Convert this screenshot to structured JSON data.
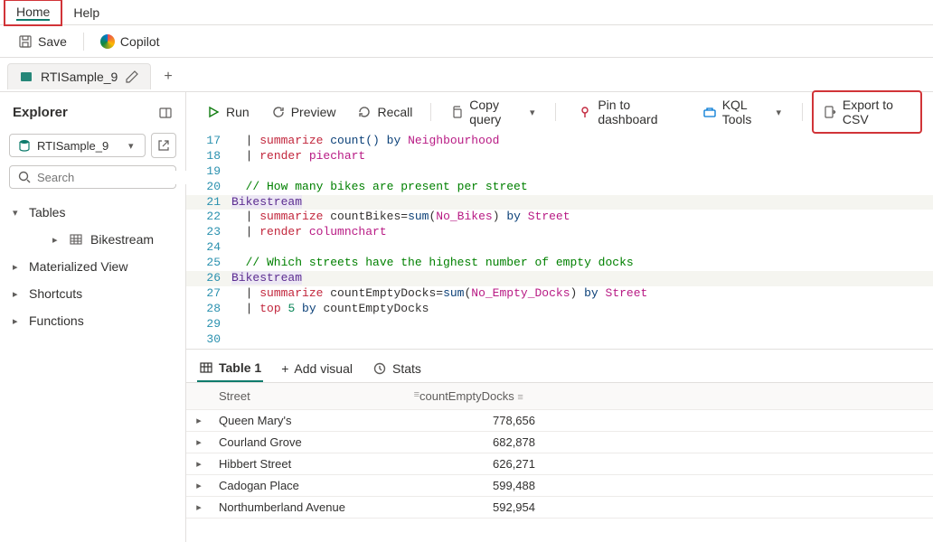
{
  "menu": {
    "home": "Home",
    "help": "Help"
  },
  "actions": {
    "save": "Save",
    "copilot": "Copilot"
  },
  "file_tab": {
    "name": "RTISample_9"
  },
  "explorer": {
    "title": "Explorer",
    "db": "RTISample_9",
    "search_placeholder": "Search",
    "tree": {
      "tables": "Tables",
      "bikestream": "Bikestream",
      "matview": "Materialized View",
      "shortcuts": "Shortcuts",
      "functions": "Functions"
    }
  },
  "toolbar": {
    "run": "Run",
    "preview": "Preview",
    "recall": "Recall",
    "copy": "Copy query",
    "pin": "Pin to dashboard",
    "kql": "KQL Tools",
    "export": "Export to CSV"
  },
  "editor_lines": [
    {
      "n": 17,
      "tokens": [
        [
          "pipe",
          "  | "
        ],
        [
          "op",
          "summarize "
        ],
        [
          "func",
          "count() "
        ],
        [
          "kw",
          "by "
        ],
        [
          "ident",
          "Neighbourhood"
        ]
      ]
    },
    {
      "n": 18,
      "tokens": [
        [
          "pipe",
          "  | "
        ],
        [
          "op",
          "render "
        ],
        [
          "ident",
          "piechart"
        ]
      ]
    },
    {
      "n": 19,
      "tokens": []
    },
    {
      "n": 20,
      "tokens": [
        [
          "comment",
          "  // How many bikes are present per street"
        ]
      ]
    },
    {
      "n": 21,
      "hl": true,
      "tokens": [
        [
          "table",
          "Bikestream"
        ]
      ]
    },
    {
      "n": 22,
      "tokens": [
        [
          "pipe",
          "  | "
        ],
        [
          "op",
          "summarize "
        ],
        [
          "plain",
          "countBikes="
        ],
        [
          "func",
          "sum"
        ],
        [
          "plain",
          "("
        ],
        [
          "ident",
          "No_Bikes"
        ],
        [
          "plain",
          ") "
        ],
        [
          "kw",
          "by "
        ],
        [
          "ident",
          "Street"
        ]
      ]
    },
    {
      "n": 23,
      "tokens": [
        [
          "pipe",
          "  | "
        ],
        [
          "op",
          "render "
        ],
        [
          "ident",
          "columnchart"
        ]
      ]
    },
    {
      "n": 24,
      "tokens": []
    },
    {
      "n": 25,
      "tokens": [
        [
          "comment",
          "  // Which streets have the highest number of empty docks"
        ]
      ]
    },
    {
      "n": 26,
      "hl": true,
      "tokens": [
        [
          "table",
          "Bikestream"
        ]
      ]
    },
    {
      "n": 27,
      "tokens": [
        [
          "pipe",
          "  | "
        ],
        [
          "op",
          "summarize "
        ],
        [
          "plain",
          "countEmptyDocks="
        ],
        [
          "func",
          "sum"
        ],
        [
          "plain",
          "("
        ],
        [
          "ident",
          "No_Empty_Docks"
        ],
        [
          "plain",
          ") "
        ],
        [
          "kw",
          "by "
        ],
        [
          "ident",
          "Street"
        ]
      ]
    },
    {
      "n": 28,
      "tokens": [
        [
          "pipe",
          "  | "
        ],
        [
          "op",
          "top "
        ],
        [
          "num",
          "5 "
        ],
        [
          "kw",
          "by "
        ],
        [
          "plain",
          "countEmptyDocks"
        ]
      ]
    },
    {
      "n": 29,
      "tokens": []
    },
    {
      "n": 30,
      "tokens": []
    }
  ],
  "results": {
    "tabs": {
      "table": "Table 1",
      "addvisual": "Add visual",
      "stats": "Stats"
    },
    "columns": {
      "street": "Street",
      "count": "countEmptyDocks"
    },
    "rows": [
      {
        "street": "Queen Mary's",
        "count": "778,656"
      },
      {
        "street": "Courland Grove",
        "count": "682,878"
      },
      {
        "street": "Hibbert Street",
        "count": "626,271"
      },
      {
        "street": "Cadogan Place",
        "count": "599,488"
      },
      {
        "street": "Northumberland Avenue",
        "count": "592,954"
      }
    ]
  }
}
